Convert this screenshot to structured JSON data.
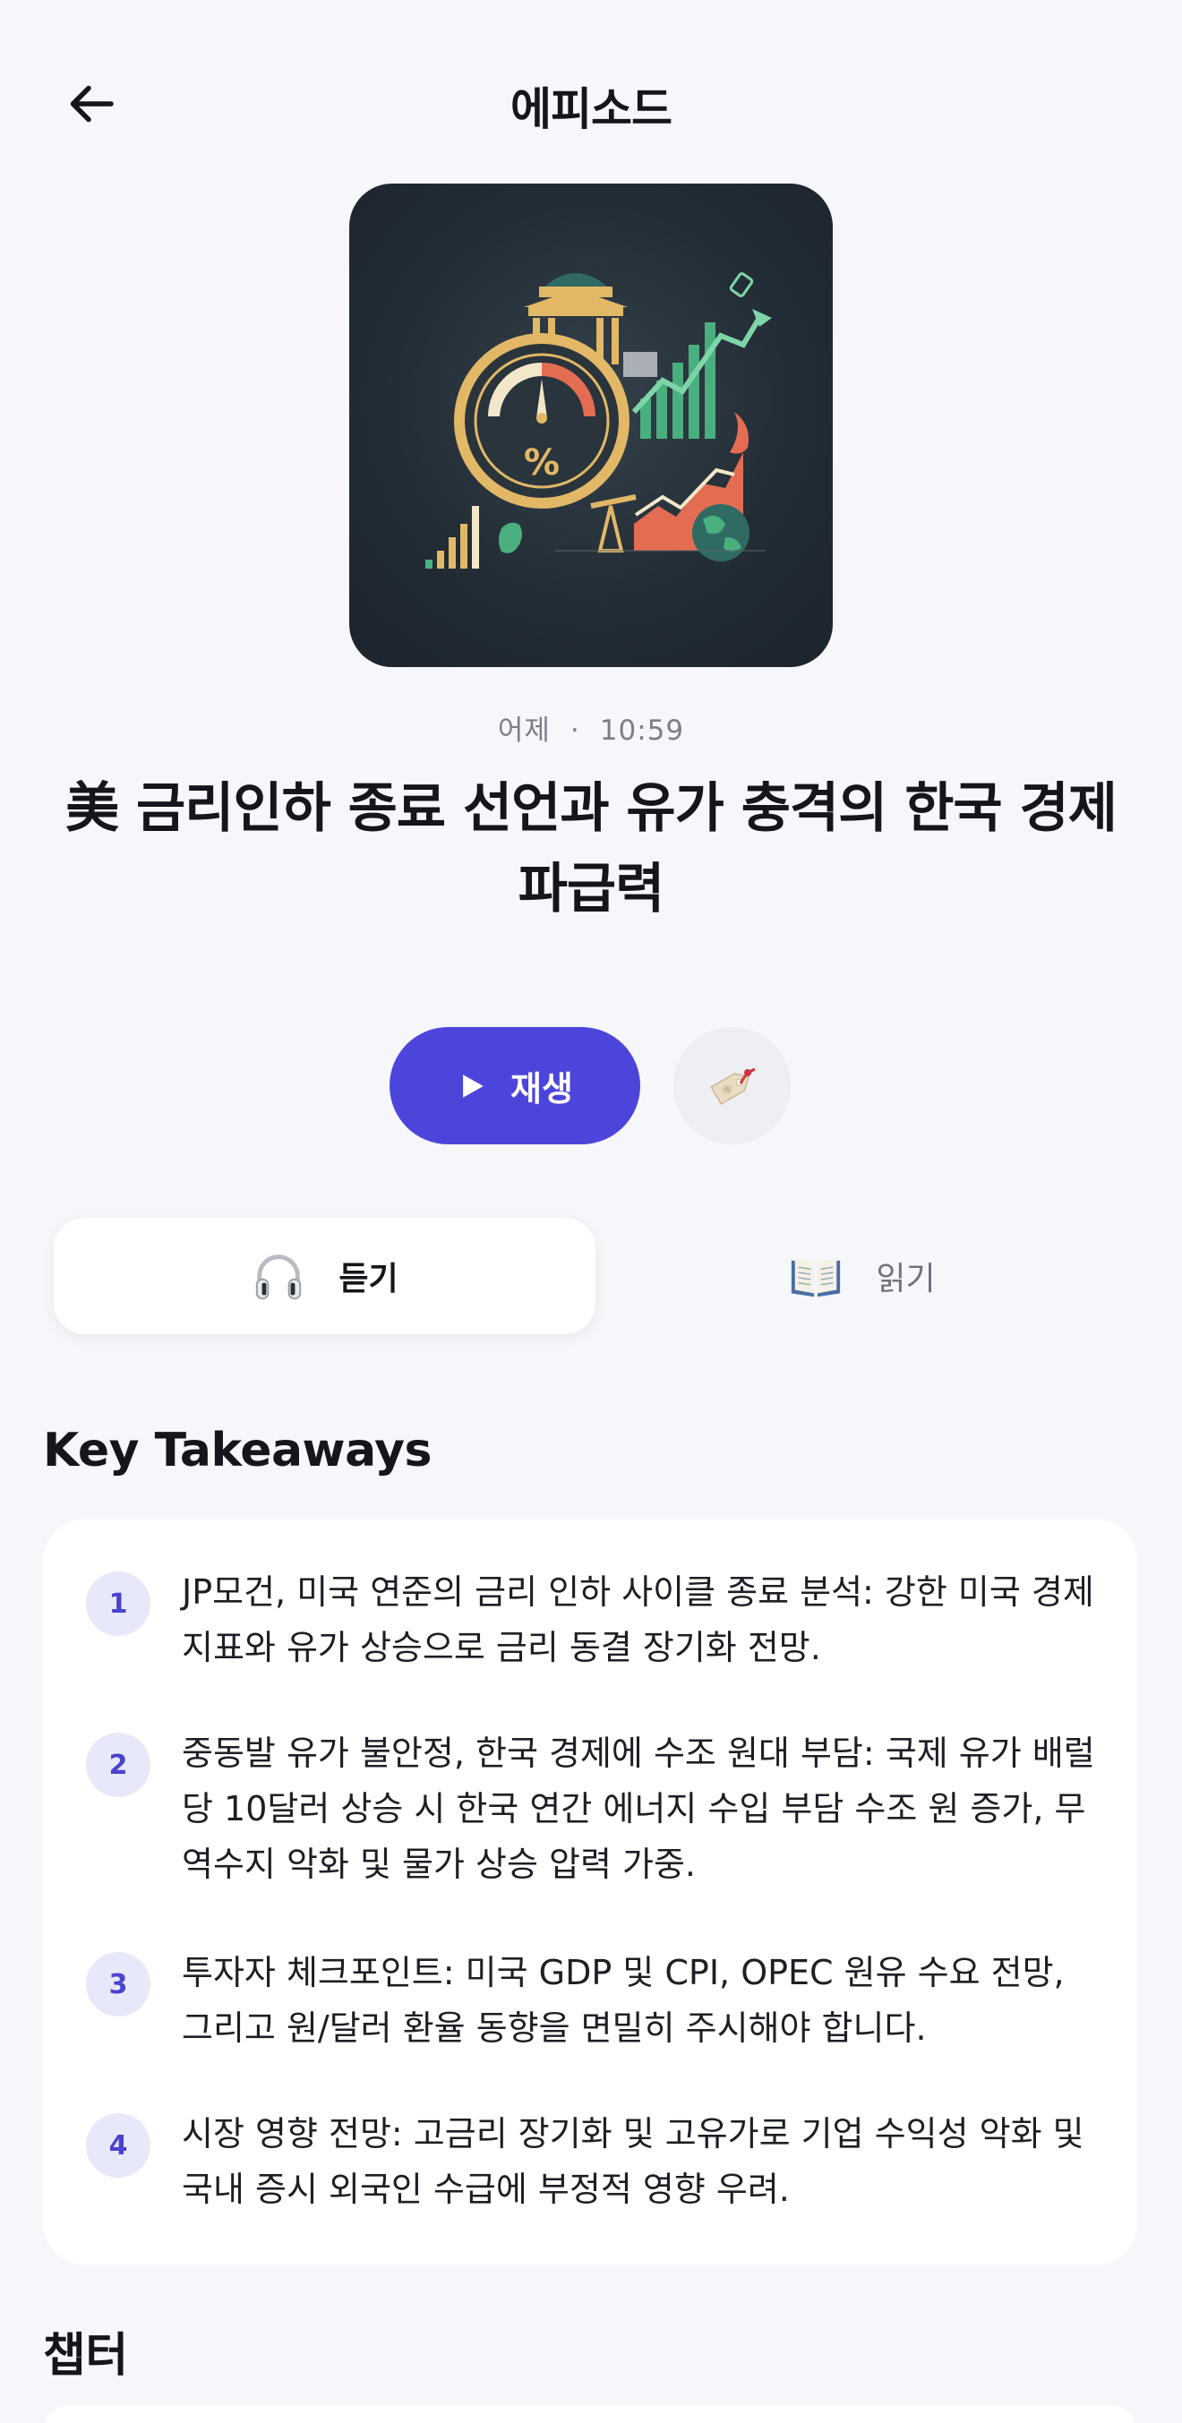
{
  "header": {
    "title": "에피소드"
  },
  "episode": {
    "date": "어제",
    "duration": "10:59",
    "title": "美 금리인하 종료 선언과 유가 충격의 한국 경제 파급력"
  },
  "actions": {
    "play_label": "재생"
  },
  "tabs": [
    {
      "label": "듣기",
      "active": true
    },
    {
      "label": "읽기",
      "active": false
    }
  ],
  "key_takeaways": {
    "title": "Key Takeaways",
    "items": [
      {
        "num": "1",
        "text": "JP모건, 미국 연준의 금리 인하 사이클 종료 분석: 강한 미국 경제 지표와 유가 상승으로 금리 동결 장기화 전망."
      },
      {
        "num": "2",
        "text": "중동발 유가 불안정, 한국 경제에 수조 원대 부담: 국제 유가 배럴당 10달러 상승 시 한국 연간 에너지 수입 부담 수조 원 증가, 무역수지 악화 및 물가 상승 압력 가중."
      },
      {
        "num": "3",
        "text": "투자자 체크포인트: 미국 GDP 및 CPI, OPEC 원유 수요 전망, 그리고 원/달러 환율 동향을 면밀히 주시해야 합니다."
      },
      {
        "num": "4",
        "text": "시장 영향 전망: 고금리 장기화 및 고유가로 기업 수익성 악화 및 국내 증시 외국인 수급에 부정적 영향 우려."
      }
    ]
  },
  "chapters": {
    "title": "챕터"
  },
  "colors": {
    "accent": "#4d45db",
    "background": "#f6f7fb",
    "badge_bg": "#e8e8fb",
    "badge_text": "#4a43cf"
  },
  "icons": {
    "back": "arrow-left-icon",
    "play": "play-icon",
    "tag": "bookmark-tag-icon",
    "listen": "headphones-icon",
    "read": "open-book-icon"
  }
}
